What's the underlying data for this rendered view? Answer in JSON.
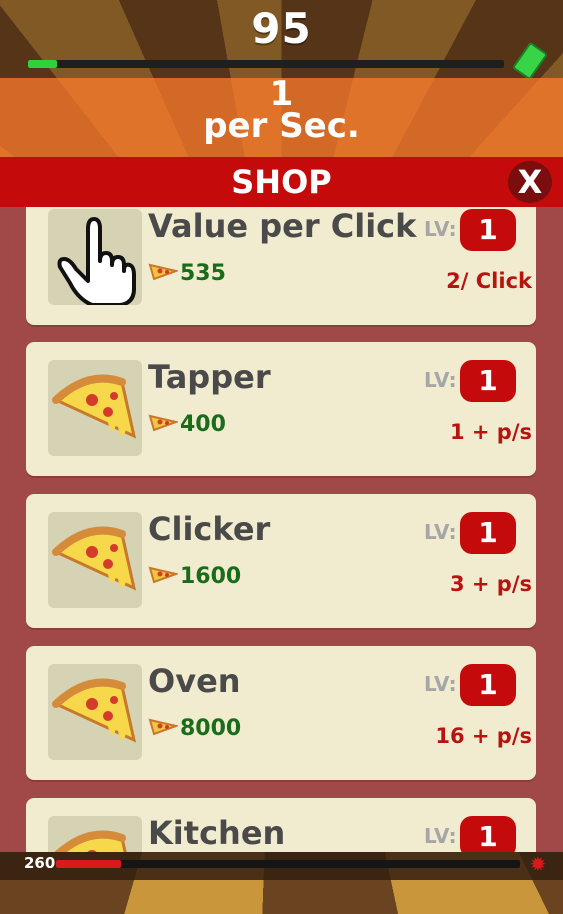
{
  "header": {
    "score": "95",
    "progress_fraction": 0.06,
    "cash_icon": "cash-icon"
  },
  "rate": {
    "value": "1",
    "label": "per Sec."
  },
  "shop": {
    "title": "SHOP",
    "close_label": "X",
    "items": [
      {
        "name": "Value per Click",
        "icon": "pointer-hand-icon",
        "cost": "535",
        "level_label": "LV:",
        "level": "1",
        "effect": "2/ Click"
      },
      {
        "name": "Tapper",
        "icon": "pizza-slice-icon",
        "cost": "400",
        "level_label": "LV:",
        "level": "1",
        "effect": "1 + p/s"
      },
      {
        "name": "Clicker",
        "icon": "pizza-slice-icon",
        "cost": "1600",
        "level_label": "LV:",
        "level": "1",
        "effect": "3 + p/s"
      },
      {
        "name": "Oven",
        "icon": "pizza-slice-icon",
        "cost": "8000",
        "level_label": "LV:",
        "level": "1",
        "effect": "16 + p/s"
      },
      {
        "name": "Kitchen",
        "icon": "pizza-slice-icon",
        "cost": "",
        "level_label": "LV:",
        "level": "1",
        "effect": ""
      }
    ]
  },
  "footer": {
    "value": "260",
    "progress_fraction": 0.14,
    "icon": "splat-icon"
  },
  "colors": {
    "shop_red": "#c40a0a",
    "panel": "#a14848",
    "card": "#f1ecd0",
    "cost_green": "#1a6b1a",
    "effect_red": "#b8140f"
  }
}
